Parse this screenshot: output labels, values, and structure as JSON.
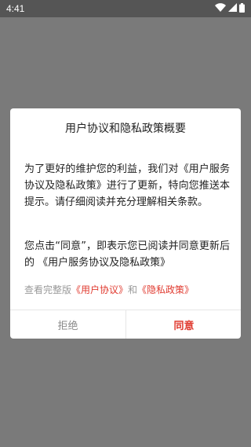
{
  "status_bar": {
    "time": "4:41",
    "icons": [
      "wifi-icon",
      "signal-icon",
      "battery-icon"
    ]
  },
  "dialog": {
    "title": "用户协议和隐私政策概要",
    "paragraph1": "为了更好的维护您的利益，我们对《用户服务协议及隐私政策》进行了更新，特向您推送本提示。请仔细阅读并充分理解相关条款。",
    "paragraph2": "您点击“同意”，即表示您已阅读并同意更新后的 《用户服务协议及隐私政策》",
    "links": {
      "prefix": "查看完整版",
      "user_agreement": "《用户协议》",
      "conjunction": "和",
      "privacy_policy": "《隐私政策》"
    },
    "buttons": {
      "reject": "拒绝",
      "agree": "同意"
    }
  },
  "colors": {
    "accent": "#e03a2f",
    "overlay": "#7a7a7a",
    "status_bar": "#555555"
  }
}
